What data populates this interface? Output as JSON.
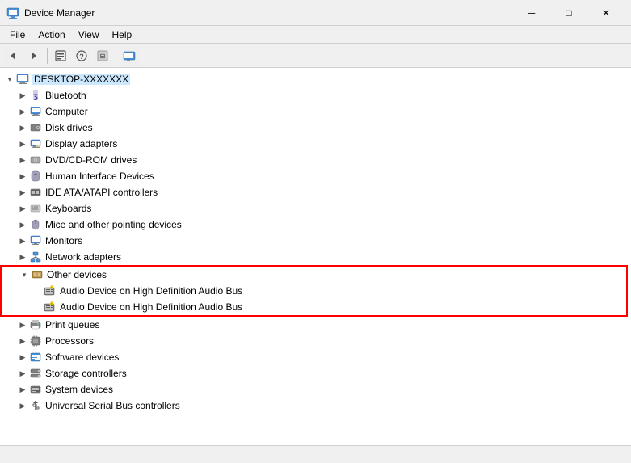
{
  "window": {
    "title": "Device Manager",
    "controls": {
      "minimize": "─",
      "maximize": "□",
      "close": "✕"
    }
  },
  "menubar": {
    "items": [
      "File",
      "Action",
      "View",
      "Help"
    ]
  },
  "toolbar": {
    "buttons": [
      "◀",
      "▶",
      "⊞",
      "?",
      "⊟",
      "🖥"
    ]
  },
  "tree": {
    "root": {
      "label": "DESKTOP-XXXXXXX",
      "expanded": true
    },
    "items": [
      {
        "id": "bluetooth",
        "label": "Bluetooth",
        "level": 1,
        "icon": "bluetooth",
        "expanded": false
      },
      {
        "id": "computer",
        "label": "Computer",
        "level": 1,
        "icon": "computer",
        "expanded": false
      },
      {
        "id": "disk-drives",
        "label": "Disk drives",
        "level": 1,
        "icon": "disk",
        "expanded": false
      },
      {
        "id": "display-adapters",
        "label": "Display adapters",
        "level": 1,
        "icon": "display",
        "expanded": false
      },
      {
        "id": "dvd-rom",
        "label": "DVD/CD-ROM drives",
        "level": 1,
        "icon": "dvd",
        "expanded": false
      },
      {
        "id": "hid",
        "label": "Human Interface Devices",
        "level": 1,
        "icon": "hid",
        "expanded": false
      },
      {
        "id": "ide",
        "label": "IDE ATA/ATAPI controllers",
        "level": 1,
        "icon": "ide",
        "expanded": false
      },
      {
        "id": "keyboards",
        "label": "Keyboards",
        "level": 1,
        "icon": "keyboard",
        "expanded": false
      },
      {
        "id": "mice",
        "label": "Mice and other pointing devices",
        "level": 1,
        "icon": "mouse",
        "expanded": false
      },
      {
        "id": "monitors",
        "label": "Monitors",
        "level": 1,
        "icon": "monitor",
        "expanded": false
      },
      {
        "id": "network",
        "label": "Network adapters",
        "level": 1,
        "icon": "network",
        "expanded": false
      },
      {
        "id": "other-devices",
        "label": "Other devices",
        "level": 1,
        "icon": "other",
        "expanded": true,
        "highlighted": true,
        "children": [
          {
            "id": "audio1",
            "label": "Audio Device on High Definition Audio Bus",
            "level": 2,
            "icon": "warning-audio",
            "highlighted": true
          },
          {
            "id": "audio2",
            "label": "Audio Device on High Definition Audio Bus",
            "level": 2,
            "icon": "warning-audio",
            "highlighted": true
          }
        ]
      },
      {
        "id": "print-queues",
        "label": "Print queues",
        "level": 1,
        "icon": "print",
        "expanded": false
      },
      {
        "id": "processors",
        "label": "Processors",
        "level": 1,
        "icon": "processor",
        "expanded": false
      },
      {
        "id": "software-devices",
        "label": "Software devices",
        "level": 1,
        "icon": "software",
        "expanded": false
      },
      {
        "id": "storage",
        "label": "Storage controllers",
        "level": 1,
        "icon": "storage",
        "expanded": false
      },
      {
        "id": "system-devices",
        "label": "System devices",
        "level": 1,
        "icon": "system",
        "expanded": false
      },
      {
        "id": "usb",
        "label": "Universal Serial Bus controllers",
        "level": 1,
        "icon": "usb",
        "expanded": false
      }
    ]
  },
  "statusbar": {
    "text": ""
  }
}
